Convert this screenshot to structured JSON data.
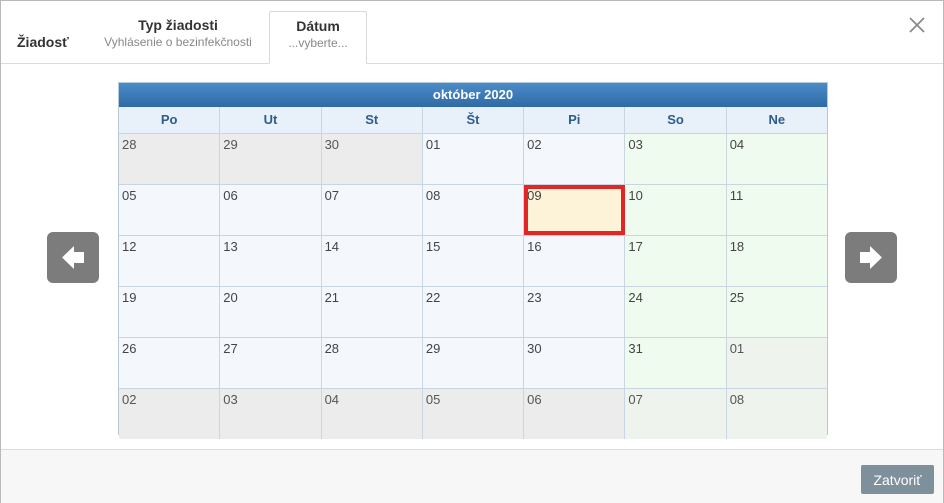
{
  "header": {
    "title": "Žiadosť",
    "tabs": [
      {
        "label": "Typ žiadosti",
        "sub": "Vyhlásenie o bezinfekčnosti"
      },
      {
        "label": "Dátum",
        "sub": "...vyberte..."
      }
    ],
    "close_icon": "close-icon"
  },
  "calendar": {
    "title": "október 2020",
    "weekdays": [
      "Po",
      "Ut",
      "St",
      "Št",
      "Pi",
      "So",
      "Ne"
    ],
    "selected": "09",
    "weeks": [
      [
        {
          "d": "28",
          "m": "other"
        },
        {
          "d": "29",
          "m": "other"
        },
        {
          "d": "30",
          "m": "other"
        },
        {
          "d": "01",
          "m": "cur"
        },
        {
          "d": "02",
          "m": "cur"
        },
        {
          "d": "03",
          "m": "cur"
        },
        {
          "d": "04",
          "m": "cur"
        }
      ],
      [
        {
          "d": "05",
          "m": "cur"
        },
        {
          "d": "06",
          "m": "cur"
        },
        {
          "d": "07",
          "m": "cur"
        },
        {
          "d": "08",
          "m": "cur"
        },
        {
          "d": "09",
          "m": "cur",
          "selected": true
        },
        {
          "d": "10",
          "m": "cur"
        },
        {
          "d": "11",
          "m": "cur"
        }
      ],
      [
        {
          "d": "12",
          "m": "cur"
        },
        {
          "d": "13",
          "m": "cur"
        },
        {
          "d": "14",
          "m": "cur"
        },
        {
          "d": "15",
          "m": "cur"
        },
        {
          "d": "16",
          "m": "cur"
        },
        {
          "d": "17",
          "m": "cur"
        },
        {
          "d": "18",
          "m": "cur"
        }
      ],
      [
        {
          "d": "19",
          "m": "cur"
        },
        {
          "d": "20",
          "m": "cur"
        },
        {
          "d": "21",
          "m": "cur"
        },
        {
          "d": "22",
          "m": "cur"
        },
        {
          "d": "23",
          "m": "cur"
        },
        {
          "d": "24",
          "m": "cur"
        },
        {
          "d": "25",
          "m": "cur"
        }
      ],
      [
        {
          "d": "26",
          "m": "cur"
        },
        {
          "d": "27",
          "m": "cur"
        },
        {
          "d": "28",
          "m": "cur"
        },
        {
          "d": "29",
          "m": "cur"
        },
        {
          "d": "30",
          "m": "cur"
        },
        {
          "d": "31",
          "m": "cur"
        },
        {
          "d": "01",
          "m": "other"
        }
      ],
      [
        {
          "d": "02",
          "m": "other"
        },
        {
          "d": "03",
          "m": "other"
        },
        {
          "d": "04",
          "m": "other"
        },
        {
          "d": "05",
          "m": "other"
        },
        {
          "d": "06",
          "m": "other"
        },
        {
          "d": "07",
          "m": "other"
        },
        {
          "d": "08",
          "m": "other"
        }
      ]
    ]
  },
  "nav": {
    "prev_icon": "arrow-left-icon",
    "next_icon": "arrow-right-icon"
  },
  "footer": {
    "close_label": "Zatvoriť"
  },
  "colors": {
    "title_bar": "#2f6aa6",
    "selected_border": "#e32525",
    "selected_bg": "#fdf3d8",
    "nav_button": "#7c7c7c",
    "close_button": "#7e909c"
  }
}
